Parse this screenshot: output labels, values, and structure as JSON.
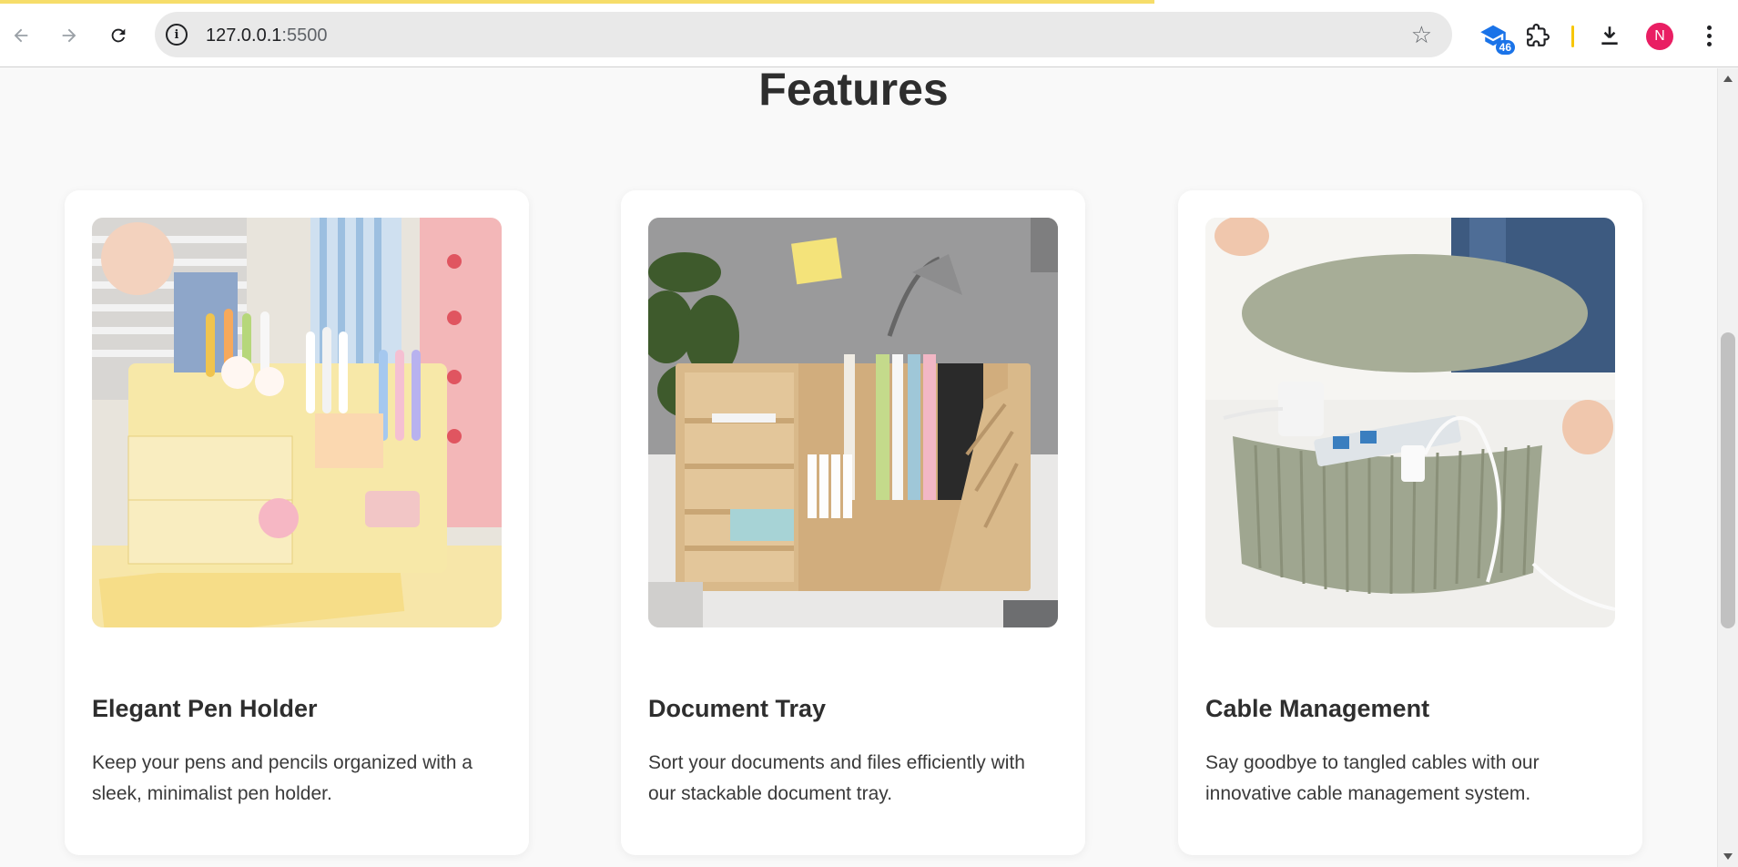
{
  "browser": {
    "url_host": "127.0.0.1",
    "url_port": ":5500",
    "extension_badge": "46",
    "profile_initial": "N"
  },
  "page": {
    "section_title": "Features",
    "cards": [
      {
        "title": "Elegant Pen Holder",
        "description": "Keep your pens and pencils organized with a sleek, minimalist pen holder.",
        "image": "pen-holder-photo"
      },
      {
        "title": "Document Tray",
        "description": "Sort your documents and files efficiently with our stackable document tray.",
        "image": "document-tray-photo"
      },
      {
        "title": "Cable Management",
        "description": "Say goodbye to tangled cables with our innovative cable management system.",
        "image": "cable-box-photo"
      }
    ]
  },
  "colors": {
    "page_bg": "#f9f9f9",
    "card_bg": "#ffffff",
    "text_dark": "#2e2e2e",
    "omnibox_bg": "#e9e9e9",
    "load_bar": "#f6dd6a",
    "avatar": "#e91e63"
  }
}
